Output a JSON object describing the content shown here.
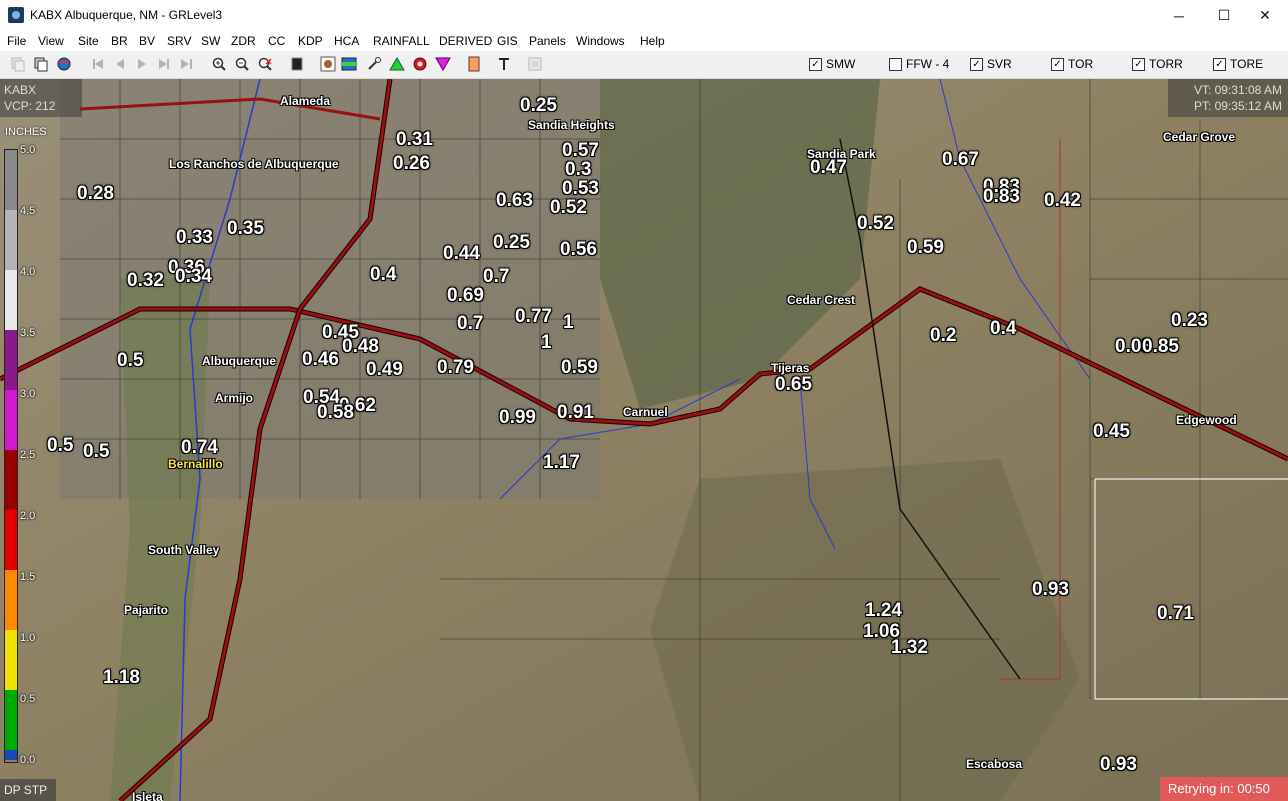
{
  "window": {
    "title": "KABX Albuquerque, NM - GRLevel3",
    "minimize_glyph": "─",
    "maximize_glyph": "☐",
    "close_glyph": "✕"
  },
  "menu": [
    "File",
    "View",
    "Site",
    "BR",
    "BV",
    "SRV",
    "SW",
    "ZDR",
    "CC",
    "KDP",
    "HCA",
    "RAINFALL",
    "DERIVED",
    "GIS",
    "Panels",
    "Windows",
    "Help"
  ],
  "toolbar": {
    "icons": [
      "copy-icon",
      "paste-icon",
      "globe-icon",
      "first-frame-icon",
      "prev-frame-icon",
      "play-icon",
      "next-frame-icon",
      "last-frame-icon",
      "zoom-in-icon",
      "zoom-out-icon",
      "zoom-reset-icon",
      "layer-icon",
      "storm-icon",
      "colorbar-icon",
      "pin-icon",
      "triangle-icon",
      "circle-icon",
      "inverted-triangle-icon",
      "marker-icon",
      "text-tool-icon",
      "square-icon"
    ],
    "warnings": [
      {
        "label": "SMW",
        "checked": true
      },
      {
        "label": "FFW - 4",
        "checked": false
      },
      {
        "label": "SVR",
        "checked": true
      },
      {
        "label": "TOR",
        "checked": true
      },
      {
        "label": "TORR",
        "checked": true
      },
      {
        "label": "TORE",
        "checked": true
      }
    ]
  },
  "radar": {
    "site": "KABX",
    "vcp": "VCP: 212",
    "valid_time": "VT: 09:31:08 AM",
    "product_time": "PT: 09:35:12 AM"
  },
  "legend": {
    "unit": "INCHES",
    "ticks": [
      "5.0",
      "4.5",
      "4.0",
      "3.5",
      "3.0",
      "2.5",
      "2.0",
      "1.5",
      "1.0",
      "0.5",
      "0.0"
    ],
    "colors": [
      "#8a8a8a",
      "#b4b4b4",
      "#e8e8e8",
      "#8a1a8a",
      "#d01ad0",
      "#9a0000",
      "#e00000",
      "#ff8a00",
      "#f2e200",
      "#00aa00",
      "#1a4ab4",
      "#000000"
    ]
  },
  "places": [
    {
      "name": "Alameda"
    },
    {
      "name": "Sandia Heights"
    },
    {
      "name": "Los Ranchos de Albuquerque"
    },
    {
      "name": "Sandia Park"
    },
    {
      "name": "Cedar Grove"
    },
    {
      "name": "Cedar Crest"
    },
    {
      "name": "Albuquerque"
    },
    {
      "name": "Tijeras"
    },
    {
      "name": "Armijo"
    },
    {
      "name": "Carnuel"
    },
    {
      "name": "Edgewood"
    },
    {
      "name": "Bernalillo"
    },
    {
      "name": "South Valley"
    },
    {
      "name": "Pajarito"
    },
    {
      "name": "Escabosa"
    },
    {
      "name": "Isleta"
    }
  ],
  "rain_values": [
    "0.25",
    "0.31",
    "0.26",
    "0.57",
    "0.3",
    "0.53",
    "0.52",
    "0.63",
    "0.28",
    "0.35",
    "0.33",
    "0.25",
    "0.56",
    "0.44",
    "0.36",
    "0.34",
    "0.32",
    "0.4",
    "0.7",
    "0.69",
    "0.77",
    "1",
    "0.45",
    "0.7",
    "0.48",
    "1",
    "0.5",
    "0.46",
    "0.49",
    "0.79",
    "0.59",
    "0.54",
    "0.62",
    "0.58",
    "0.99",
    "0.91",
    "0.5",
    "0.5",
    "0.74",
    "1.17",
    "0.67",
    "0.47",
    "0.83",
    "0.83",
    "0.42",
    "0.52",
    "0.59",
    "0.2",
    "0.4",
    "0.08",
    "0.85",
    "0.23",
    "0.65",
    "0.45",
    "0.93",
    "0.71",
    "1.24",
    "1.06",
    "1.32",
    "1.18",
    "0.93"
  ],
  "status": {
    "mode": "DP STP",
    "retry": "Retrying in: 00:50"
  }
}
